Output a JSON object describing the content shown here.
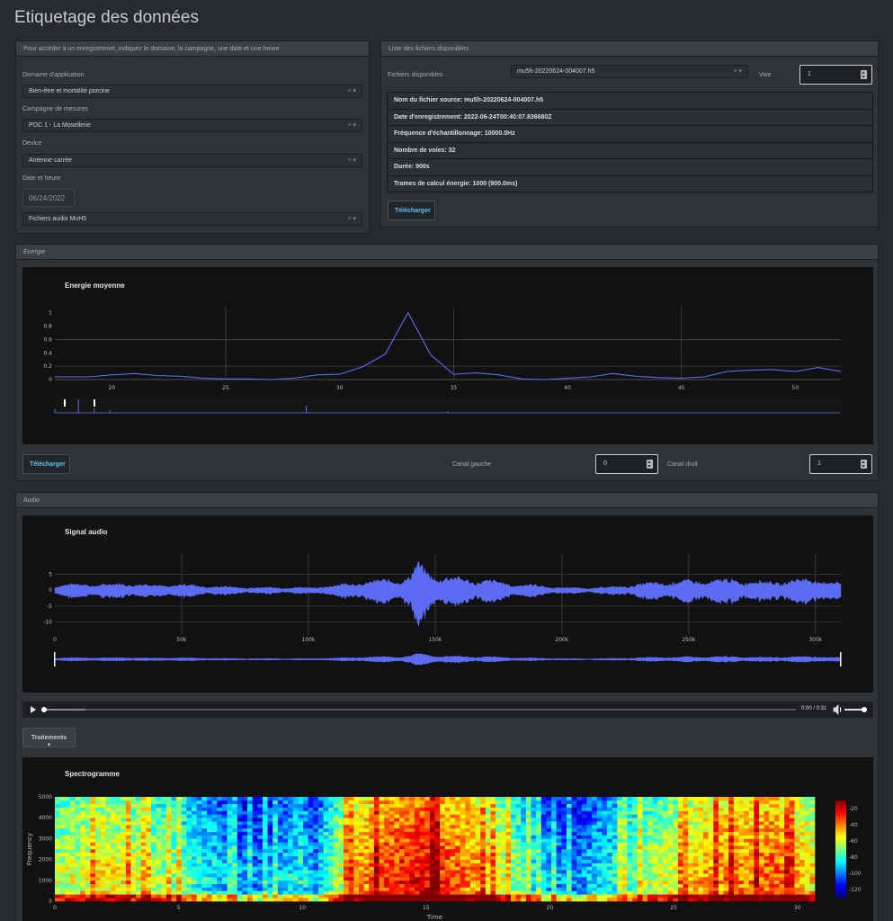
{
  "page": {
    "title": "Etiquetage des données"
  },
  "access_panel": {
    "header": "Pour accéder à un enregistremet, indiquez le domaine, la campagne, une date et une heure",
    "domain_label": "Domaine d'application",
    "domain_value": "Bien-être et mortalité porcine",
    "campaign_label": "Campagne de mesures",
    "campaign_value": "POC 1 - La Mosellerie",
    "device_label": "Device",
    "device_value": "Antenne carrée",
    "datetime_label": "Date et heure",
    "date_value": "06/24/2022",
    "filetype_value": "Fichiers audio MuH5",
    "clear_symbol": "×",
    "caret_symbol": "▾"
  },
  "files_panel": {
    "header": "Liste des fichiers disponibles",
    "files_label": "Fichiers disponibles",
    "file_value": "mu5h-20220624-004007.h5",
    "voie_label": "Voie",
    "voie_value": "1",
    "info_rows": [
      "Nom du fichier source: mu5h-20220624-004007.h5",
      "Date d'enregistrement: 2022-06-24T00:40:07.836680Z",
      "Fréquence d'échantillonnage: 10000.0Hz",
      "Nombre de voies: 32",
      "Durée: 900s",
      "Trames de calcul énergie: 1000 (900.0ms)"
    ],
    "download_label": "Télécharger"
  },
  "energy_panel": {
    "header": "Energie",
    "download_label": "Télécharger",
    "left_channel_label": "Canal gauche",
    "left_channel_value": "0",
    "right_channel_label": "Canal droit",
    "right_channel_value": "1"
  },
  "audio_panel": {
    "header": "Audio",
    "player_time": "0:00 / 0:31",
    "treatments_label": "Traitements ▾"
  },
  "colors": {
    "series": "#5b6cf2",
    "background": "#272b30",
    "plot_bg": "#111111",
    "link": "#62c1f5"
  },
  "chart_data": [
    {
      "type": "line",
      "title": "Energie moyenne",
      "xlabel": "",
      "ylabel": "",
      "xlim": [
        17.5,
        52
      ],
      "ylim": [
        0,
        1.05
      ],
      "x_ticks": [
        20,
        25,
        30,
        35,
        40,
        45,
        50
      ],
      "y_ticks": [
        0,
        0.2,
        0.4,
        0.6,
        0.8,
        1
      ],
      "grid": true,
      "x": [
        17.5,
        19,
        20,
        21,
        22,
        23,
        24,
        25,
        26,
        27,
        28,
        29,
        30,
        31,
        32,
        33,
        34,
        35,
        36,
        37,
        38,
        39,
        40,
        41,
        42,
        43,
        44,
        45,
        46,
        47,
        48,
        49,
        50,
        51,
        52
      ],
      "y": [
        0.04,
        0.04,
        0.07,
        0.09,
        0.06,
        0.05,
        0.02,
        0.01,
        0.01,
        0.0,
        0.02,
        0.07,
        0.08,
        0.19,
        0.38,
        1.0,
        0.37,
        0.08,
        0.1,
        0.07,
        0.01,
        0.0,
        0.02,
        0.04,
        0.09,
        0.05,
        0.03,
        0.02,
        0.04,
        0.12,
        0.14,
        0.15,
        0.12,
        0.18,
        0.12
      ]
    },
    {
      "type": "line",
      "title": "Signal audio",
      "xlabel": "",
      "ylabel": "",
      "xlim": [
        0,
        310000
      ],
      "ylim": [
        -11,
        8
      ],
      "x_ticks": [
        0,
        50000,
        100000,
        150000,
        200000,
        250000,
        300000
      ],
      "x_tick_labels": [
        "0",
        "50k",
        "100k",
        "150k",
        "200k",
        "250k",
        "300k"
      ],
      "y_ticks": [
        5,
        0,
        -5,
        -10
      ],
      "grid": true,
      "envelope_x": [
        0,
        10000,
        20000,
        30000,
        40000,
        50000,
        60000,
        70000,
        80000,
        90000,
        100000,
        110000,
        120000,
        130000,
        140000,
        143000,
        146000,
        150000,
        160000,
        170000,
        180000,
        190000,
        200000,
        210000,
        220000,
        230000,
        240000,
        250000,
        260000,
        270000,
        280000,
        290000,
        300000,
        310000
      ],
      "envelope_amp": [
        1.5,
        2.0,
        1.8,
        2.2,
        1.5,
        1.8,
        1.3,
        1.0,
        0.8,
        0.9,
        0.8,
        1.5,
        2.5,
        3.0,
        4.0,
        8.0,
        6.0,
        4.5,
        3.5,
        3.0,
        2.0,
        1.5,
        0.8,
        0.7,
        1.0,
        1.8,
        2.5,
        2.8,
        3.0,
        3.2,
        2.5,
        3.0,
        3.5,
        2.0
      ]
    },
    {
      "type": "heatmap",
      "title": "Spectrogramme",
      "xlabel": "Time",
      "ylabel": "Frequency",
      "xlim": [
        0,
        30.7
      ],
      "ylim": [
        0,
        5000
      ],
      "x_ticks": [
        0,
        5,
        10,
        15,
        20,
        25,
        30
      ],
      "y_ticks": [
        0,
        1000,
        2000,
        3000,
        4000,
        5000
      ],
      "colorbar_ticks": [
        -20,
        -40,
        -60,
        -80,
        -100,
        -120
      ],
      "colorbar_range": [
        -130,
        -10
      ],
      "time_profile_t": [
        0,
        2,
        4,
        5,
        6,
        7,
        8,
        9,
        10,
        10.5,
        11,
        12,
        13,
        14,
        15,
        16,
        17,
        18,
        19,
        20,
        21,
        22,
        23,
        24,
        25,
        26,
        27,
        28,
        29,
        30,
        30.7
      ],
      "time_profile_level": [
        0.6,
        0.7,
        0.6,
        0.55,
        0.45,
        0.35,
        0.3,
        0.35,
        0.45,
        0.3,
        0.5,
        0.75,
        0.85,
        0.9,
        0.95,
        0.85,
        0.8,
        0.65,
        0.5,
        0.35,
        0.3,
        0.4,
        0.5,
        0.6,
        0.65,
        0.75,
        0.8,
        0.8,
        0.85,
        0.75,
        0.7
      ]
    }
  ]
}
